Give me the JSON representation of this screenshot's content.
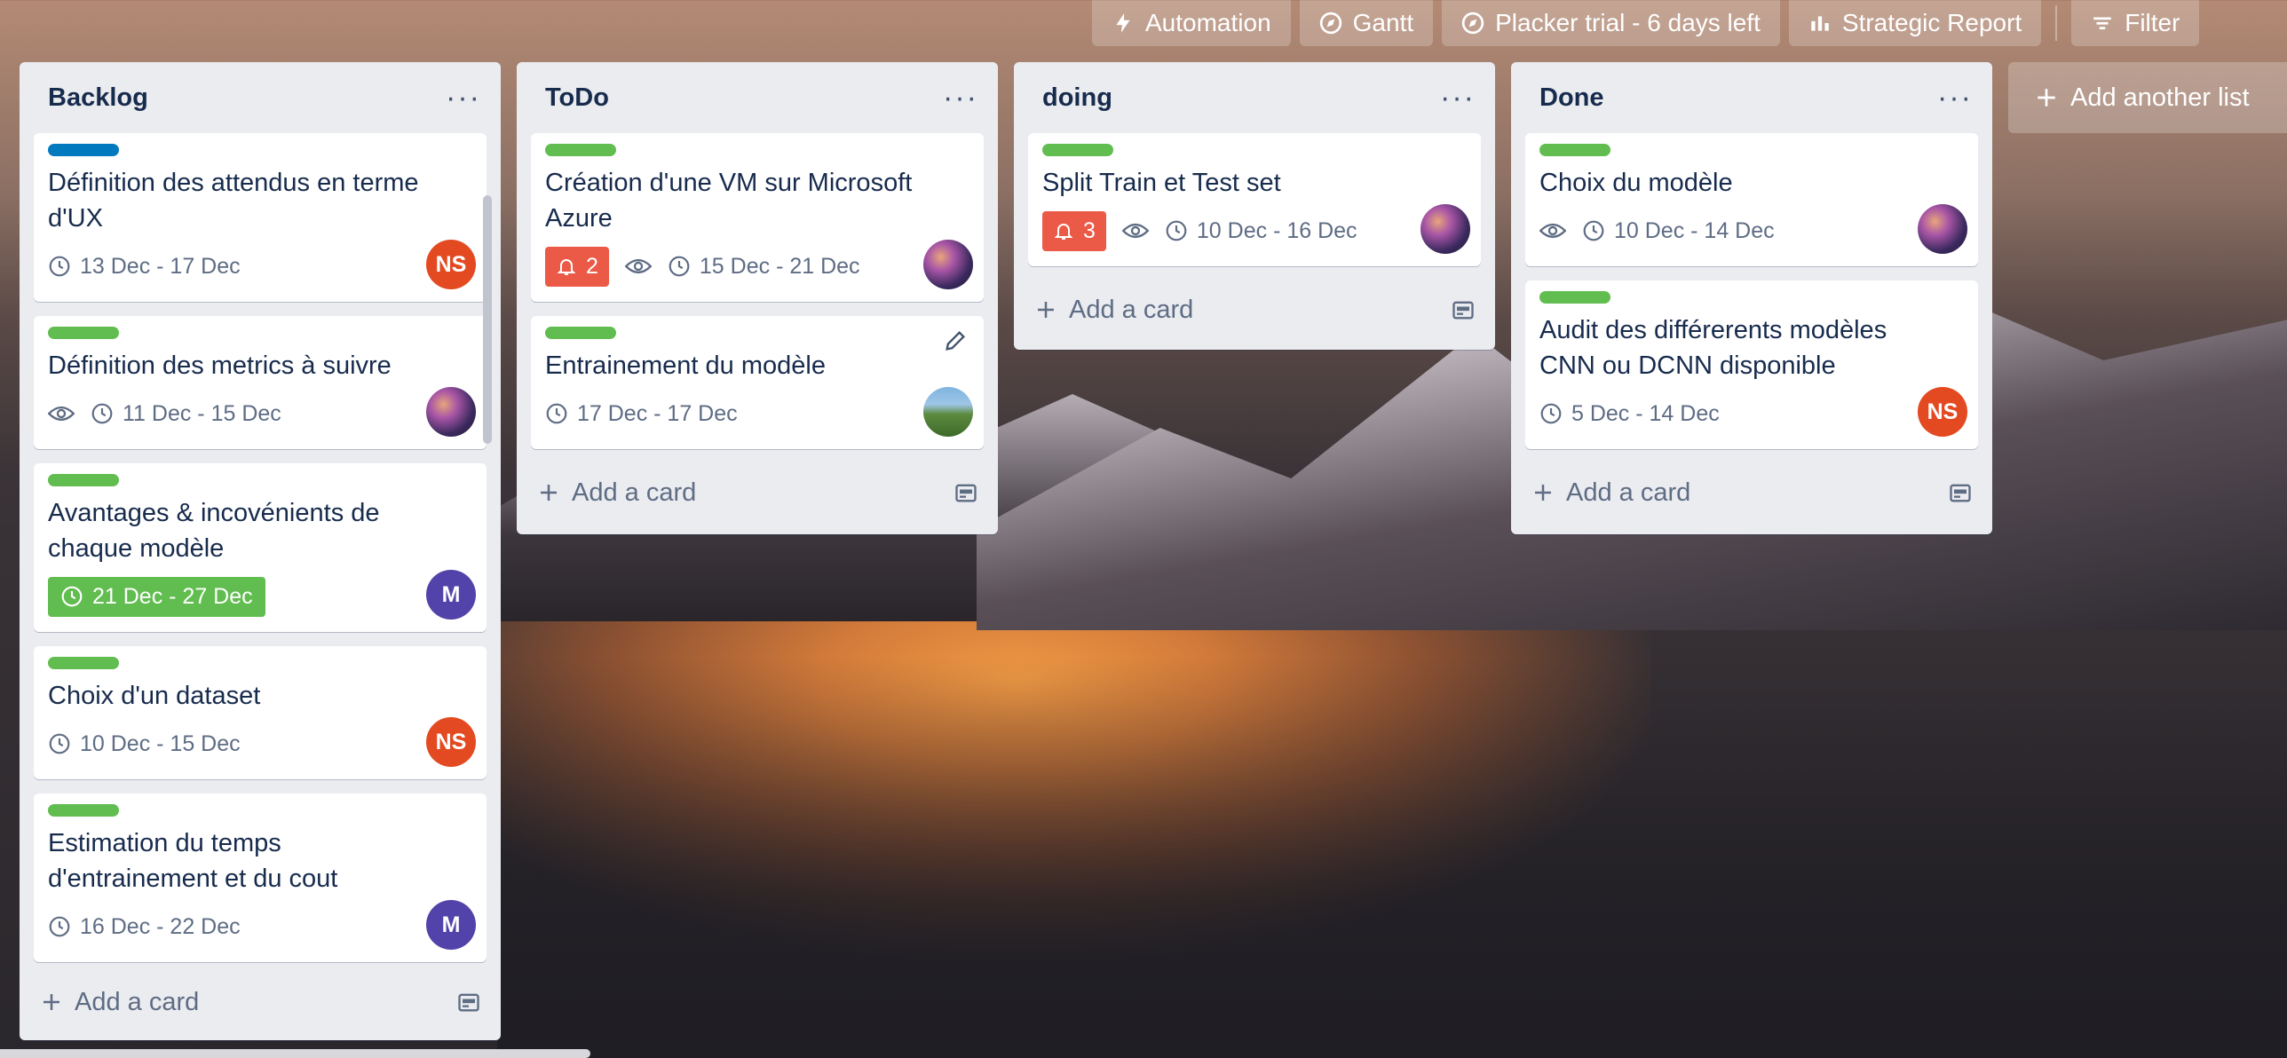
{
  "toolbar": {
    "automation": "Automation",
    "gantt": "Gantt",
    "placker": "Placker trial - 6 days left",
    "strategic": "Strategic Report",
    "filter": "Filter"
  },
  "add_list_label": "Add another list",
  "add_card_label": "Add a card",
  "colors": {
    "label_green": "#61bd4f",
    "label_blue": "#0079bf",
    "badge_red": "#eb5a46"
  },
  "lists": [
    {
      "title": "Backlog",
      "cards": [
        {
          "label": "blue",
          "title": "Définition des attendus en terme d'UX",
          "dates": "13 Dec - 17 Dec",
          "avatar": "NS"
        },
        {
          "label": "green",
          "title": "Définition des metrics à suivre",
          "dates": "11 Dec - 15 Dec",
          "avatar": "photo"
        },
        {
          "label": "green",
          "title": "Avantages & incovénients de chaque modèle",
          "dates": "21 Dec - 27 Dec",
          "avatar": "M"
        },
        {
          "label": "green",
          "title": "Choix d'un dataset",
          "dates": "10 Dec - 15 Dec",
          "avatar": "NS"
        },
        {
          "label": "green",
          "title": "Estimation du temps d'entrainement et du cout",
          "dates": "16 Dec - 22 Dec",
          "avatar": "M"
        }
      ]
    },
    {
      "title": "ToDo",
      "cards": [
        {
          "label": "green",
          "title": "Création d'une VM sur Microsoft Azure",
          "notifications": "2",
          "dates": "15 Dec - 21 Dec",
          "avatar": "photo"
        },
        {
          "label": "green",
          "title": "Entrainement du modèle",
          "dates": "17 Dec - 17 Dec",
          "avatar": "landscape"
        }
      ]
    },
    {
      "title": "doing",
      "cards": [
        {
          "label": "green",
          "title": "Split Train et Test set",
          "notifications": "3",
          "dates": "10 Dec - 16 Dec",
          "avatar": "photo"
        }
      ]
    },
    {
      "title": "Done",
      "cards": [
        {
          "label": "green",
          "title": "Choix du modèle",
          "dates": "10 Dec - 14 Dec",
          "avatar": "photo"
        },
        {
          "label": "green",
          "title": "Audit des différerents modèles CNN ou DCNN disponible",
          "dates": "5 Dec - 14 Dec",
          "avatar": "NS"
        }
      ]
    }
  ]
}
